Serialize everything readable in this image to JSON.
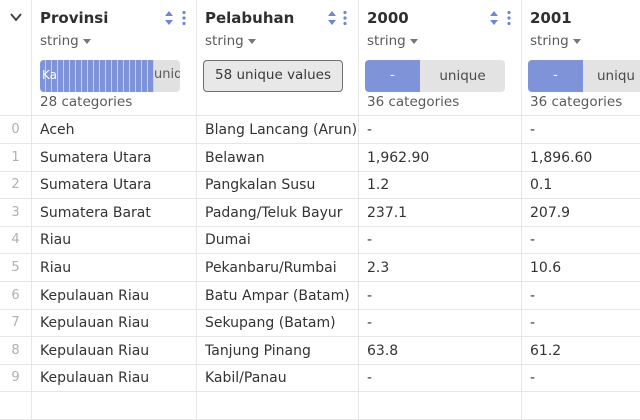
{
  "header": {
    "corner_icon": "chevron-down-icon",
    "columns": [
      {
        "title": "Provinsi",
        "type": "string",
        "viz_label_left": "Ka",
        "viz_label_right": "uniq",
        "categories": "28 categories"
      },
      {
        "title": "Pelabuhan",
        "type": "string",
        "unique_values": "58 unique values",
        "categories": ""
      },
      {
        "title": "2000",
        "type": "string",
        "viz_left": "-",
        "viz_right": "unique",
        "categories": "36 categories"
      },
      {
        "title": "2001",
        "type": "string",
        "viz_left": "-",
        "viz_right": "uniqu",
        "categories": "36 categories"
      }
    ]
  },
  "rows": [
    {
      "index": "0",
      "provinsi": "Aceh",
      "pelabuhan": "Blang Lancang (Arun)",
      "y2000": "-",
      "y2001": "-"
    },
    {
      "index": "1",
      "provinsi": "Sumatera Utara",
      "pelabuhan": "Belawan",
      "y2000": "1,962.90",
      "y2001": "1,896.60"
    },
    {
      "index": "2",
      "provinsi": "Sumatera Utara",
      "pelabuhan": "Pangkalan Susu",
      "y2000": "1.2",
      "y2001": "0.1"
    },
    {
      "index": "3",
      "provinsi": "Sumatera Barat",
      "pelabuhan": "Padang/Teluk Bayur",
      "y2000": "237.1",
      "y2001": "207.9"
    },
    {
      "index": "4",
      "provinsi": "Riau",
      "pelabuhan": "Dumai",
      "y2000": "-",
      "y2001": "-"
    },
    {
      "index": "5",
      "provinsi": "Riau",
      "pelabuhan": "Pekanbaru/Rumbai",
      "y2000": "2.3",
      "y2001": "10.6"
    },
    {
      "index": "6",
      "provinsi": "Kepulauan Riau",
      "pelabuhan": "Batu Ampar (Batam)",
      "y2000": "-",
      "y2001": "-"
    },
    {
      "index": "7",
      "provinsi": "Kepulauan Riau",
      "pelabuhan": "Sekupang (Batam)",
      "y2000": "-",
      "y2001": "-"
    },
    {
      "index": "8",
      "provinsi": "Kepulauan Riau",
      "pelabuhan": "Tanjung Pinang",
      "y2000": "63.8",
      "y2001": "61.2"
    },
    {
      "index": "9",
      "provinsi": "Kepulauan Riau",
      "pelabuhan": "Kabil/Panau",
      "y2000": "-",
      "y2001": "-"
    },
    {
      "index": "",
      "provinsi": "",
      "pelabuhan": "",
      "y2000": "",
      "y2001": ""
    }
  ],
  "colors": {
    "accent": "#7e93d8",
    "sort_icon": "#6f86d6",
    "grid_line": "#e6e6e6"
  }
}
